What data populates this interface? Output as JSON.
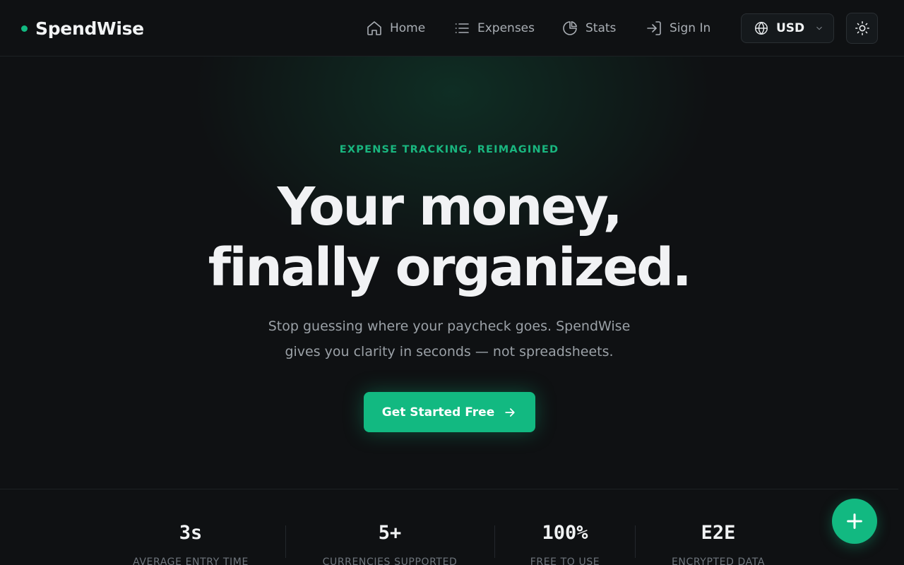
{
  "brand": {
    "name": "SpendWise",
    "accent_color": "#12b981"
  },
  "nav": {
    "items": [
      {
        "label": "Home",
        "icon": "home-icon"
      },
      {
        "label": "Expenses",
        "icon": "list-icon"
      },
      {
        "label": "Stats",
        "icon": "pie-chart-icon"
      },
      {
        "label": "Sign In",
        "icon": "sign-in-icon"
      }
    ]
  },
  "currency": {
    "selected": "USD",
    "icon": "globe-icon"
  },
  "theme_toggle": {
    "icon": "sun-icon"
  },
  "hero": {
    "eyebrow": "EXPENSE TRACKING, REIMAGINED",
    "headline_line1": "Your money,",
    "headline_line2": "finally organized.",
    "subtext_line1": "Stop guessing where your paycheck goes. SpendWise",
    "subtext_line2": "gives you clarity in seconds — not spreadsheets.",
    "cta_label": "Get Started Free"
  },
  "stats": [
    {
      "value": "3s",
      "label": "AVERAGE ENTRY TIME"
    },
    {
      "value": "5+",
      "label": "CURRENCIES SUPPORTED"
    },
    {
      "value": "100%",
      "label": "FREE TO USE"
    },
    {
      "value": "E2E",
      "label": "ENCRYPTED DATA"
    }
  ],
  "fab": {
    "icon": "plus-icon"
  }
}
